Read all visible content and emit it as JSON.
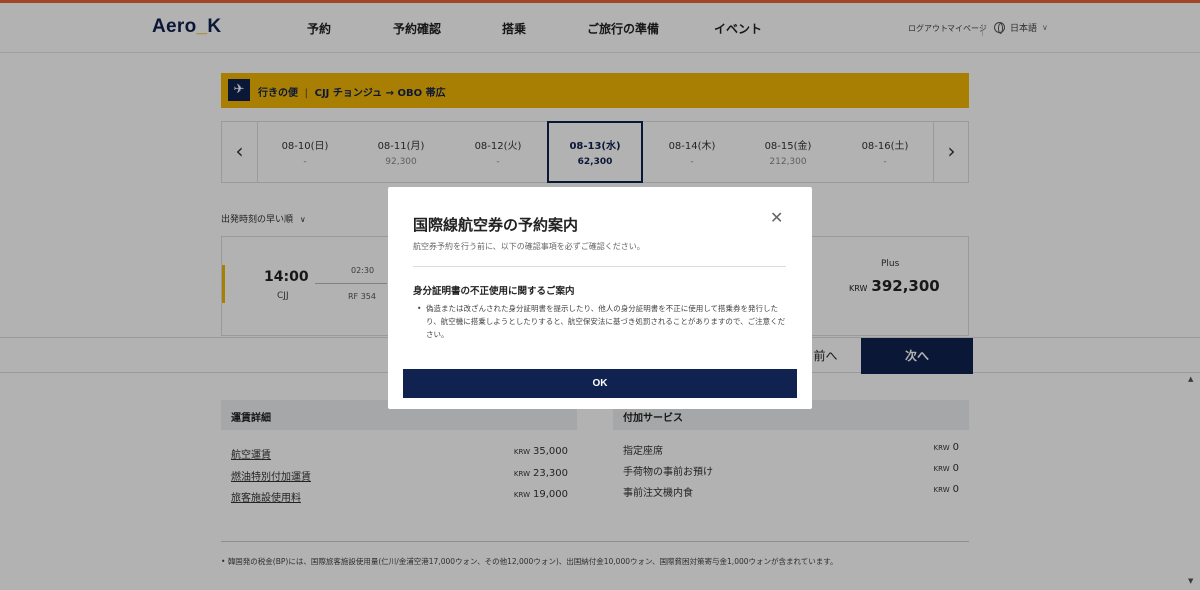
{
  "header": {
    "logo": {
      "part1": "Aero",
      "part2": "K"
    },
    "nav": [
      "予約",
      "予約確認",
      "搭乗",
      "ご旅行の準備",
      "イベント"
    ],
    "logout": "ログアウト",
    "mypage": "マイページ",
    "language": "日本語"
  },
  "route": {
    "label": "行きの便",
    "text": "CJJ チョンジュ → OBO 帯広"
  },
  "dates": [
    {
      "date": "08-10(日)",
      "price": "-"
    },
    {
      "date": "08-11(月)",
      "price": "92,300"
    },
    {
      "date": "08-12(火)",
      "price": "-"
    },
    {
      "date": "08-13(水)",
      "price": "62,300",
      "selected": true
    },
    {
      "date": "08-14(木)",
      "price": "-"
    },
    {
      "date": "08-15(金)",
      "price": "212,300"
    },
    {
      "date": "08-16(土)",
      "price": "-"
    }
  ],
  "sort": {
    "label": "出発時刻の早い順"
  },
  "flight": {
    "dep_time": "14:00",
    "dep_code": "CJJ",
    "duration": "02:30",
    "flight_no": "RF 354",
    "fare_label": "Plus",
    "currency": "KRW",
    "fare_price": "392,300"
  },
  "actions": {
    "back": "前へ",
    "next": "次へ"
  },
  "fare_details": {
    "title": "運賃詳細",
    "rows": [
      {
        "label": "航空運賃",
        "currency": "KRW",
        "value": "35,000"
      },
      {
        "label": "燃油特別付加運賃",
        "currency": "KRW",
        "value": "23,300"
      },
      {
        "label": "旅客施設使用料",
        "currency": "KRW",
        "value": "19,000"
      }
    ]
  },
  "services": {
    "title": "付加サービス",
    "rows": [
      {
        "label": "指定座席",
        "currency": "KRW",
        "value": "0"
      },
      {
        "label": "手荷物の事前お預け",
        "currency": "KRW",
        "value": "0"
      },
      {
        "label": "事前注文機内食",
        "currency": "KRW",
        "value": "0"
      }
    ]
  },
  "footnote": "韓国発の税金(BP)には、国際旅客施設使用量(仁川/金浦空港17,000ウォン、その他12,000ウォン)、出国納付金10,000ウォン、国際貧困対策寄与金1,000ウォンが含まれています。",
  "modal": {
    "title": "国際線航空券の予約案内",
    "subtitle": "航空券予約を行う前に、以下の確認事項を必ずご確認ください。",
    "section_title": "身分証明書の不正使用に関するご案内",
    "body": "偽造または改ざんされた身分証明書を提示したり、他人の身分証明書を不正に使用して搭乗券を発行したり、航空機に搭乗しようとしたりすると、航空保安法に基づき処罰されることがありますので、ご注意ください。",
    "ok": "OK"
  }
}
